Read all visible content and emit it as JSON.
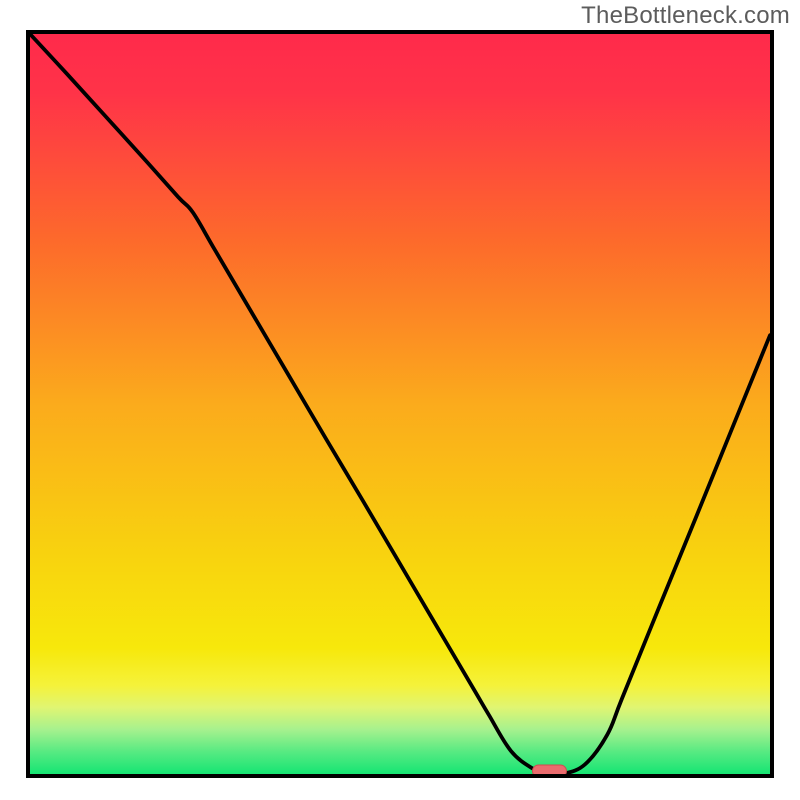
{
  "watermark": "TheBottleneck.com",
  "colors": {
    "border": "#000000",
    "curve": "#000000",
    "green": "#16e573",
    "yellow": "#f9e900",
    "orange": "#fb8b1b",
    "red": "#ff2a4b",
    "marker_fill": "#ea6c6e",
    "marker_stroke": "#d14b4e"
  },
  "chart_data": {
    "type": "line",
    "title": "",
    "xlabel": "",
    "ylabel": "",
    "xlim": [
      0,
      100
    ],
    "ylim": [
      0,
      100
    ],
    "x": [
      0,
      5,
      10,
      15,
      20,
      22,
      25,
      30,
      35,
      40,
      45,
      50,
      55,
      60,
      62,
      65,
      68,
      70,
      72,
      75,
      78,
      80,
      85,
      90,
      95,
      100
    ],
    "values": [
      100,
      94.6,
      89.1,
      83.6,
      78.0,
      75.9,
      70.8,
      62.3,
      53.8,
      45.3,
      36.9,
      28.4,
      19.9,
      11.4,
      8.0,
      3.1,
      0.7,
      0.0,
      0.0,
      1.3,
      5.3,
      10.2,
      22.5,
      34.7,
      47.0,
      59.3
    ],
    "marker": {
      "x": 70.2,
      "y": 0.4
    },
    "gradient_bands_y": [
      {
        "y0": 100,
        "y1": 15,
        "from": "red",
        "to": "yellow"
      },
      {
        "y0": 15,
        "y1": 2,
        "from": "yellow",
        "to": "green"
      },
      {
        "y0": 2,
        "y1": 0,
        "color": "green"
      }
    ]
  }
}
